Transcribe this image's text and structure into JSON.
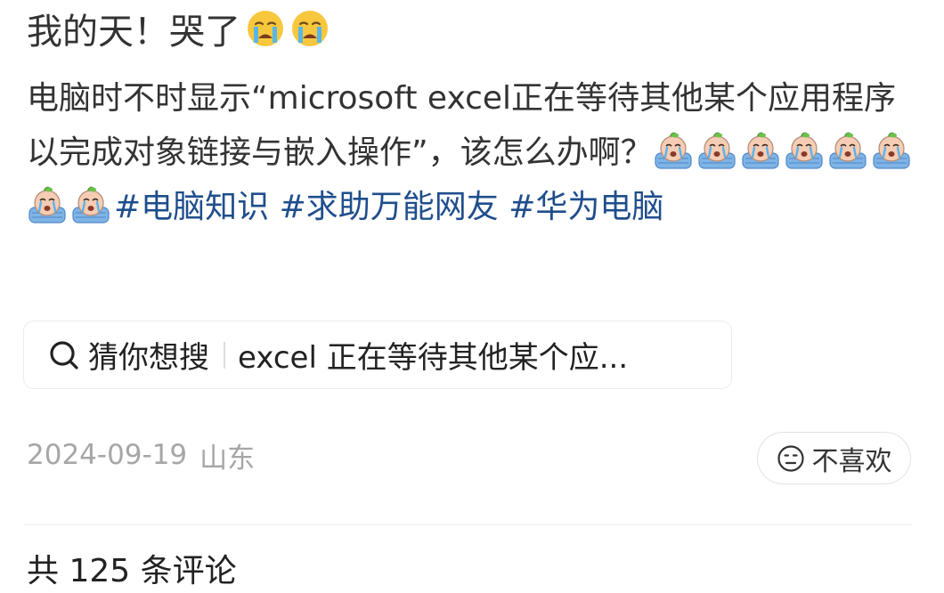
{
  "post": {
    "title": "我的天！哭了",
    "title_emojis": [
      "crying-face-icon",
      "crying-face-icon"
    ],
    "body_text": "电脑时不时显示“microsoft excel正在等待其他某个应用程序以完成对象链接与嵌入操作”，该怎么办啊？",
    "sticker_icon": "crying-baby-sticker-icon",
    "sticker_count": 8,
    "topics": [
      "#电脑知识",
      "#求助万能网友",
      "#华为电脑"
    ]
  },
  "search": {
    "icon": "search-icon",
    "label": "猜你想搜",
    "query": "excel 正在等待其他某个应..."
  },
  "meta": {
    "date": "2024-09-19",
    "location": "山东"
  },
  "dislike": {
    "icon": "neutral-face-icon",
    "label": "不喜欢"
  },
  "comments": {
    "heading": "共 125 条评论"
  },
  "colors": {
    "text": "#333333",
    "topic_link": "#1f4e8c",
    "meta": "#a6a6a6"
  }
}
